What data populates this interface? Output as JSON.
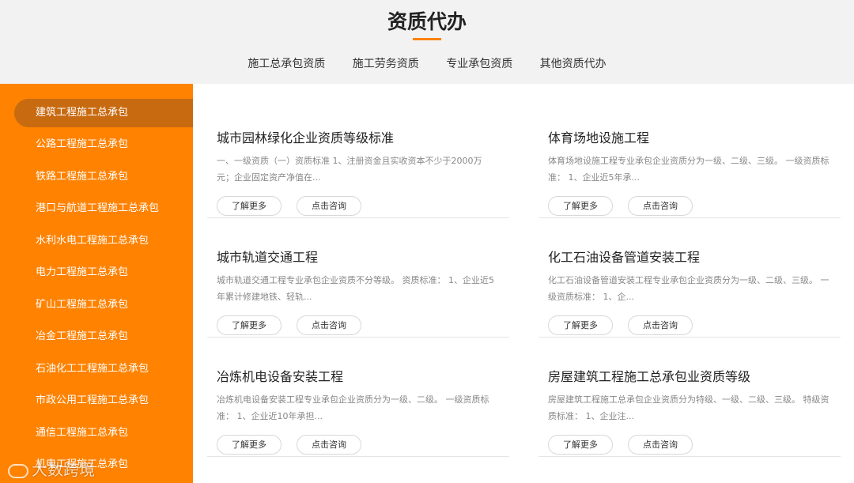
{
  "header": {
    "title": "资质代办",
    "tabs": [
      "施工总承包资质",
      "施工劳务资质",
      "专业承包资质",
      "其他资质代办"
    ]
  },
  "sidebar": {
    "items": [
      "建筑工程施工总承包",
      "公路工程施工总承包",
      "铁路工程施工总承包",
      "港口与航道工程施工总承包",
      "水利水电工程施工总承包",
      "电力工程施工总承包",
      "矿山工程施工总承包",
      "冶金工程施工总承包",
      "石油化工工程施工总承包",
      "市政公用工程施工总承包",
      "通信工程施工总承包",
      "机电工程施工总承包"
    ],
    "active_index": 0
  },
  "cards": [
    {
      "title": "城市园林绿化企业资质等级标准",
      "desc": "一、一级资质（一）资质标准 1、注册资金且实收资本不少于2000万元；企业固定资产净值在...",
      "more_label": "了解更多",
      "consult_label": "点击咨询"
    },
    {
      "title": "体育场地设施工程",
      "desc": "体育场地设施工程专业承包企业资质分为一级、二级、三级。 一级资质标准： 1、企业近5年承...",
      "more_label": "了解更多",
      "consult_label": "点击咨询"
    },
    {
      "title": "城市轨道交通工程",
      "desc": "城市轨道交通工程专业承包企业资质不分等级。 资质标准： 1、企业近5年累计修建地铁、轻轨...",
      "more_label": "了解更多",
      "consult_label": "点击咨询"
    },
    {
      "title": "化工石油设备管道安装工程",
      "desc": "化工石油设备管道安装工程专业承包企业资质分为一级、二级、三级。 一级资质标准： 1、企...",
      "more_label": "了解更多",
      "consult_label": "点击咨询"
    },
    {
      "title": "冶炼机电设备安装工程",
      "desc": "冶炼机电设备安装工程专业承包企业资质分为一级、二级。 一级资质标准： 1、企业近10年承担...",
      "more_label": "了解更多",
      "consult_label": "点击咨询"
    },
    {
      "title": "房屋建筑工程施工总承包业资质等级",
      "desc": "房屋建筑工程施工总承包企业资质分为特级、一级、二级、三级。 特级资质标准： 1、企业注...",
      "more_label": "了解更多",
      "consult_label": "点击咨询"
    }
  ],
  "watermark": "大数跨境",
  "colors": {
    "accent": "#ff8200",
    "active_item": "#c86a10",
    "header_bg": "#f2f2f2"
  }
}
